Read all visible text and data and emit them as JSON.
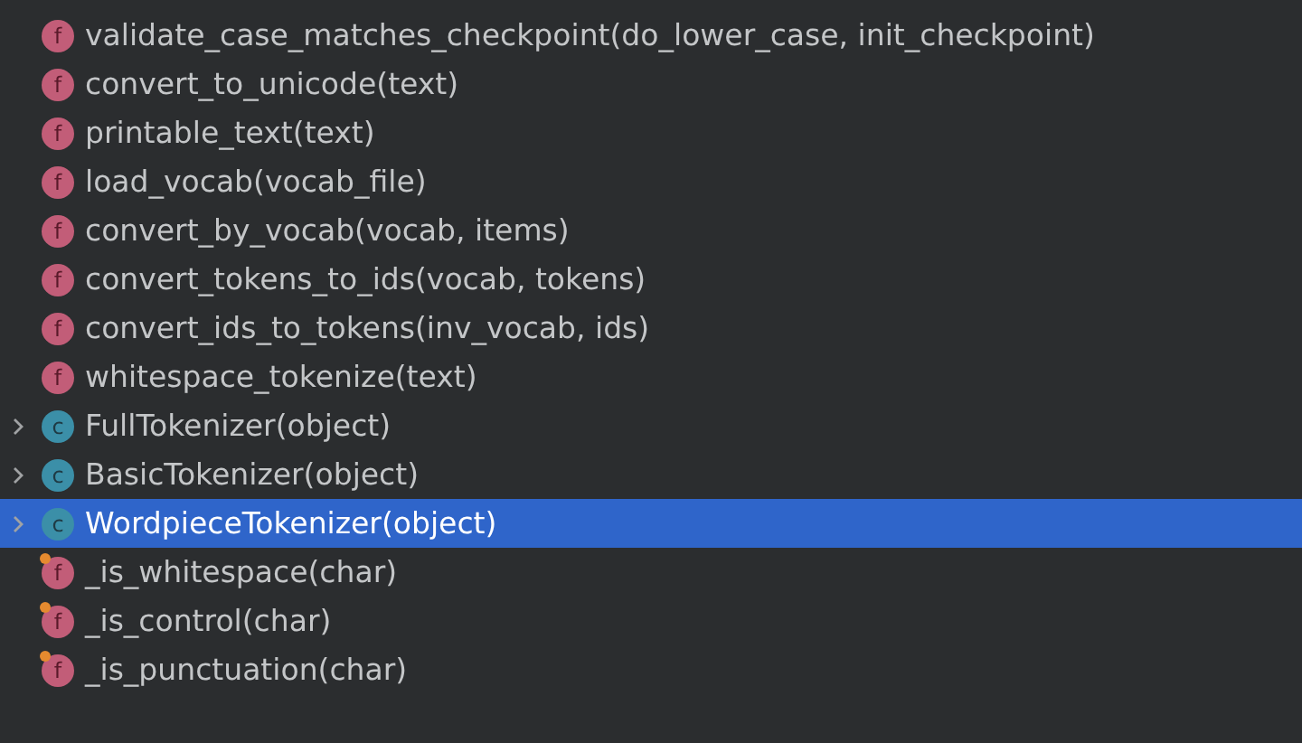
{
  "structure": [
    {
      "kind": "function",
      "badge": "f",
      "label": "validate_case_matches_checkpoint(do_lower_case, init_checkpoint)",
      "private": false,
      "expandable": false,
      "selected": false
    },
    {
      "kind": "function",
      "badge": "f",
      "label": "convert_to_unicode(text)",
      "private": false,
      "expandable": false,
      "selected": false
    },
    {
      "kind": "function",
      "badge": "f",
      "label": "printable_text(text)",
      "private": false,
      "expandable": false,
      "selected": false
    },
    {
      "kind": "function",
      "badge": "f",
      "label": "load_vocab(vocab_file)",
      "private": false,
      "expandable": false,
      "selected": false
    },
    {
      "kind": "function",
      "badge": "f",
      "label": "convert_by_vocab(vocab, items)",
      "private": false,
      "expandable": false,
      "selected": false
    },
    {
      "kind": "function",
      "badge": "f",
      "label": "convert_tokens_to_ids(vocab, tokens)",
      "private": false,
      "expandable": false,
      "selected": false
    },
    {
      "kind": "function",
      "badge": "f",
      "label": "convert_ids_to_tokens(inv_vocab, ids)",
      "private": false,
      "expandable": false,
      "selected": false
    },
    {
      "kind": "function",
      "badge": "f",
      "label": "whitespace_tokenize(text)",
      "private": false,
      "expandable": false,
      "selected": false
    },
    {
      "kind": "class",
      "badge": "c",
      "label": "FullTokenizer(object)",
      "private": false,
      "expandable": true,
      "selected": false
    },
    {
      "kind": "class",
      "badge": "c",
      "label": "BasicTokenizer(object)",
      "private": false,
      "expandable": true,
      "selected": false
    },
    {
      "kind": "class",
      "badge": "c",
      "label": "WordpieceTokenizer(object)",
      "private": false,
      "expandable": true,
      "selected": true
    },
    {
      "kind": "function",
      "badge": "f",
      "label": "_is_whitespace(char)",
      "private": true,
      "expandable": false,
      "selected": false
    },
    {
      "kind": "function",
      "badge": "f",
      "label": "_is_control(char)",
      "private": true,
      "expandable": false,
      "selected": false
    },
    {
      "kind": "function",
      "badge": "f",
      "label": "_is_punctuation(char)",
      "private": true,
      "expandable": false,
      "selected": false
    }
  ]
}
